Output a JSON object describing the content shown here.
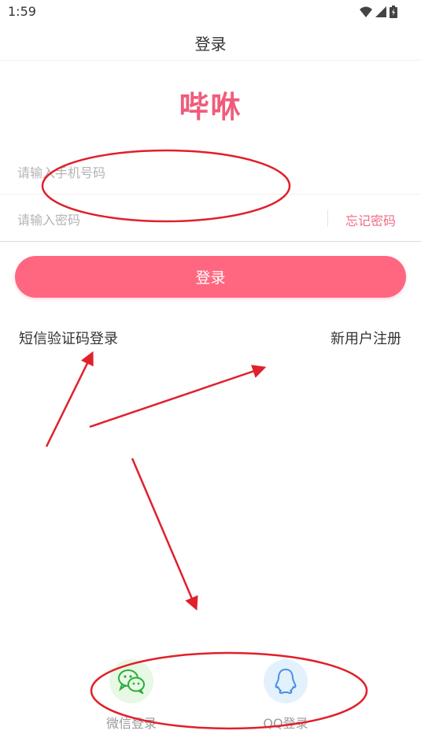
{
  "status_bar": {
    "time": "1:59"
  },
  "header": {
    "title": "登录"
  },
  "logo": {
    "text": "哔咻"
  },
  "form": {
    "phone_placeholder": "请输入手机号码",
    "password_placeholder": "请输入密码",
    "forgot_label": "忘记密码",
    "login_label": "登录"
  },
  "links": {
    "sms_login": "短信验证码登录",
    "register": "新用户注册"
  },
  "social": {
    "wechat_label": "微信登录",
    "qq_label": "QQ登录"
  },
  "colors": {
    "accent": "#ff6780",
    "wechat": "#2aae3b",
    "qq": "#4a90e2",
    "annotation": "#e0202a"
  }
}
